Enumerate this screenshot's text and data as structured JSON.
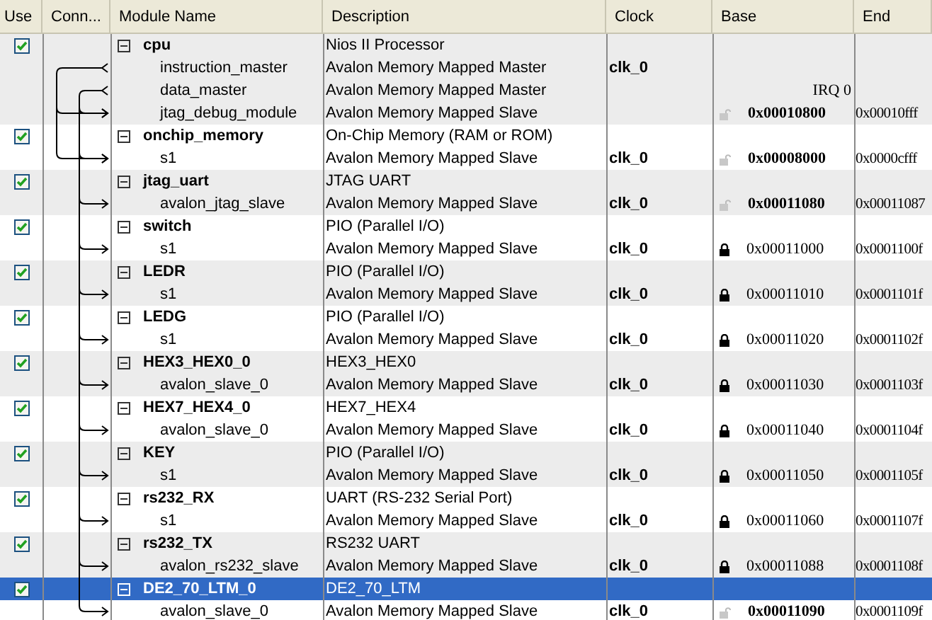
{
  "columns": [
    "Use",
    "Conn...",
    "Module Name",
    "Description",
    "Clock",
    "Base",
    "End"
  ],
  "modules": [
    {
      "name": "cpu",
      "checked": true,
      "selected": false,
      "description": "Nios II Processor",
      "children": [
        {
          "name": "instruction_master",
          "description": "Avalon Memory Mapped Master",
          "clock": "clk_0"
        },
        {
          "name": "data_master",
          "description": "Avalon Memory Mapped Master",
          "irq": "IRQ 0"
        },
        {
          "name": "jtag_debug_module",
          "description": "Avalon Memory Mapped Slave",
          "base": "0x00010800",
          "end": "0x00010fff",
          "locked": false
        }
      ]
    },
    {
      "name": "onchip_memory",
      "checked": true,
      "selected": false,
      "description": "On-Chip Memory (RAM or ROM)",
      "children": [
        {
          "name": "s1",
          "description": "Avalon Memory Mapped Slave",
          "clock": "clk_0",
          "base": "0x00008000",
          "end": "0x0000cfff",
          "locked": false
        }
      ]
    },
    {
      "name": "jtag_uart",
      "checked": true,
      "selected": false,
      "description": "JTAG UART",
      "children": [
        {
          "name": "avalon_jtag_slave",
          "description": "Avalon Memory Mapped Slave",
          "clock": "clk_0",
          "base": "0x00011080",
          "end": "0x00011087",
          "locked": false
        }
      ]
    },
    {
      "name": "switch",
      "checked": true,
      "selected": false,
      "description": "PIO (Parallel I/O)",
      "children": [
        {
          "name": "s1",
          "description": "Avalon Memory Mapped Slave",
          "clock": "clk_0",
          "base": "0x00011000",
          "end": "0x0001100f",
          "locked": true
        }
      ]
    },
    {
      "name": "LEDR",
      "checked": true,
      "selected": false,
      "description": "PIO (Parallel I/O)",
      "children": [
        {
          "name": "s1",
          "description": "Avalon Memory Mapped Slave",
          "clock": "clk_0",
          "base": "0x00011010",
          "end": "0x0001101f",
          "locked": true
        }
      ]
    },
    {
      "name": "LEDG",
      "checked": true,
      "selected": false,
      "description": "PIO (Parallel I/O)",
      "children": [
        {
          "name": "s1",
          "description": "Avalon Memory Mapped Slave",
          "clock": "clk_0",
          "base": "0x00011020",
          "end": "0x0001102f",
          "locked": true
        }
      ]
    },
    {
      "name": "HEX3_HEX0_0",
      "checked": true,
      "selected": false,
      "description": "HEX3_HEX0",
      "children": [
        {
          "name": "avalon_slave_0",
          "description": "Avalon Memory Mapped Slave",
          "clock": "clk_0",
          "base": "0x00011030",
          "end": "0x0001103f",
          "locked": true
        }
      ]
    },
    {
      "name": "HEX7_HEX4_0",
      "checked": true,
      "selected": false,
      "description": "HEX7_HEX4",
      "children": [
        {
          "name": "avalon_slave_0",
          "description": "Avalon Memory Mapped Slave",
          "clock": "clk_0",
          "base": "0x00011040",
          "end": "0x0001104f",
          "locked": true
        }
      ]
    },
    {
      "name": "KEY",
      "checked": true,
      "selected": false,
      "description": "PIO (Parallel I/O)",
      "children": [
        {
          "name": "s1",
          "description": "Avalon Memory Mapped Slave",
          "clock": "clk_0",
          "base": "0x00011050",
          "end": "0x0001105f",
          "locked": true
        }
      ]
    },
    {
      "name": "rs232_RX",
      "checked": true,
      "selected": false,
      "description": "UART (RS-232 Serial Port)",
      "children": [
        {
          "name": "s1",
          "description": "Avalon Memory Mapped Slave",
          "clock": "clk_0",
          "base": "0x00011060",
          "end": "0x0001107f",
          "locked": true
        }
      ]
    },
    {
      "name": "rs232_TX",
      "checked": true,
      "selected": false,
      "description": "RS232 UART",
      "children": [
        {
          "name": "avalon_rs232_slave",
          "description": "Avalon Memory Mapped Slave",
          "clock": "clk_0",
          "base": "0x00011088",
          "end": "0x0001108f",
          "locked": true
        }
      ]
    },
    {
      "name": "DE2_70_LTM_0",
      "checked": true,
      "selected": true,
      "description": "DE2_70_LTM",
      "children": [
        {
          "name": "avalon_slave_0",
          "description": "Avalon Memory Mapped Slave",
          "clock": "clk_0",
          "base": "0x00011090",
          "end": "0x0001109f",
          "locked": false
        }
      ]
    }
  ]
}
